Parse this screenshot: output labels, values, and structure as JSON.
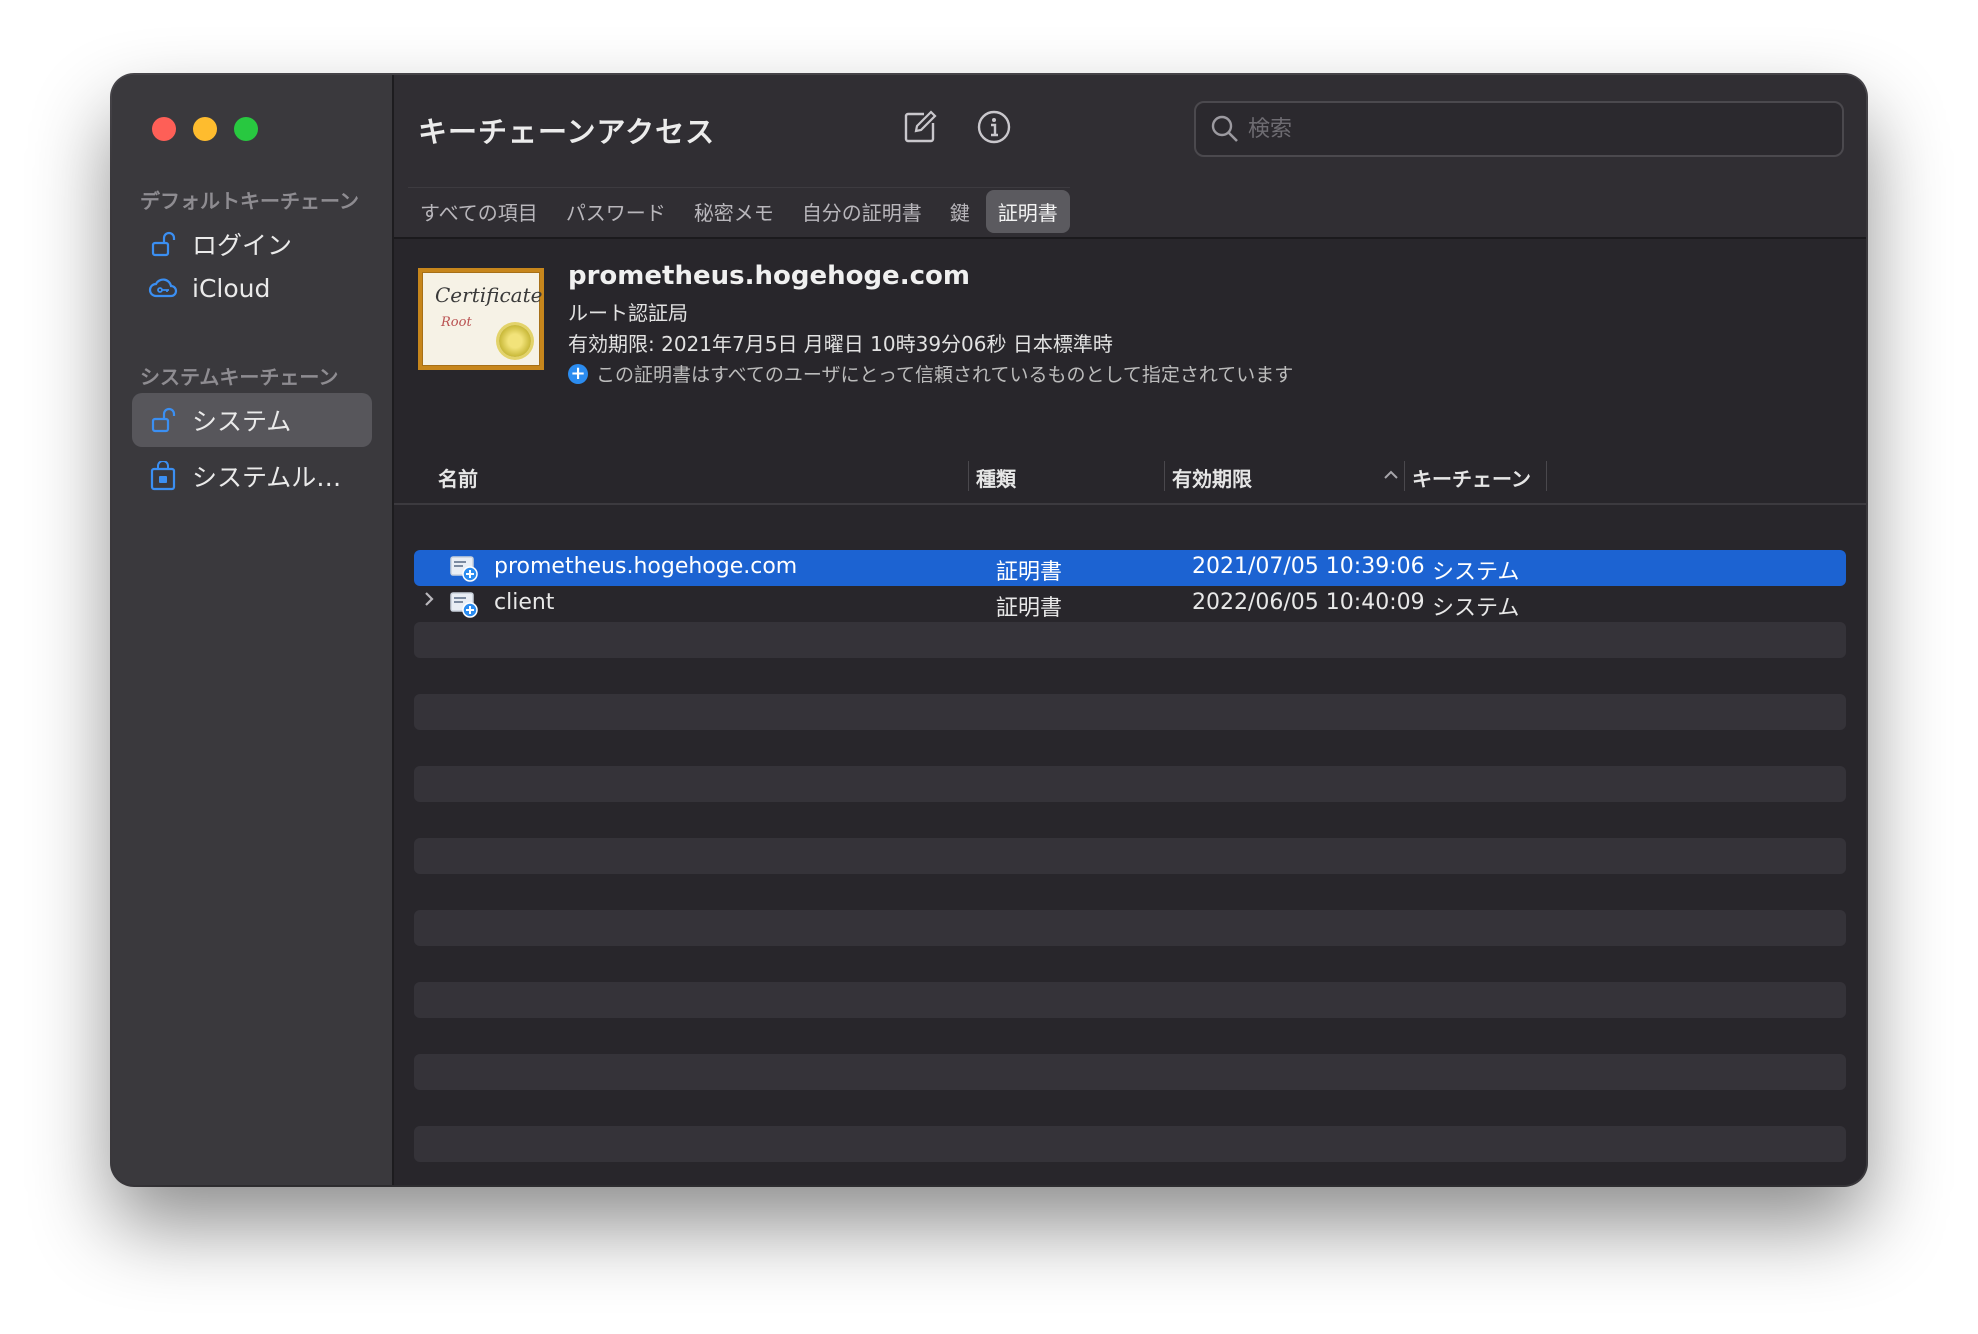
{
  "sidebar": {
    "sections": [
      {
        "label": "デフォルトキーチェーン",
        "items": [
          {
            "label": "ログイン"
          },
          {
            "label": "iCloud"
          }
        ]
      },
      {
        "label": "システムキーチェーン",
        "items": [
          {
            "label": "システム"
          },
          {
            "label": "システムル…"
          }
        ]
      }
    ]
  },
  "toolbar": {
    "title": "キーチェーンアクセス",
    "search_placeholder": "検索"
  },
  "tabs": [
    {
      "label": "すべての項目"
    },
    {
      "label": "パスワード"
    },
    {
      "label": "秘密メモ"
    },
    {
      "label": "自分の証明書"
    },
    {
      "label": "鍵"
    },
    {
      "label": "証明書"
    }
  ],
  "certificate": {
    "name": "prometheus.hogehoge.com",
    "type": "ルート認証局",
    "expiry": "有効期限: 2021年7月5日 月曜日 10時39分06秒 日本標準時",
    "trust": "この証明書はすべてのユーザにとって信頼されているものとして指定されています",
    "image_script": "Certificate",
    "image_sub": "Root"
  },
  "table": {
    "columns": [
      "名前",
      "種類",
      "有効期限",
      "キーチェーン"
    ],
    "rows": [
      {
        "name": "prometheus.hogehoge.com",
        "kind": "証明書",
        "expires": "2021/07/05 10:39:06",
        "keychain": "システム"
      },
      {
        "name": "client",
        "kind": "証明書",
        "expires": "2022/06/05 10:40:09",
        "keychain": "システム"
      }
    ]
  },
  "colors": {
    "accent": "#1c63d2",
    "sidebar_icon": "#3b8ff2"
  }
}
